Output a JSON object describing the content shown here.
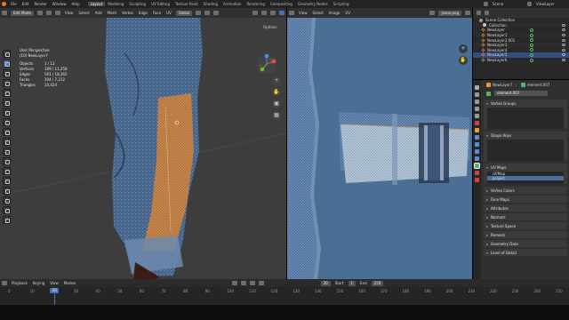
{
  "topbar": {
    "menus": [
      "File",
      "Edit",
      "Render",
      "Window",
      "Help"
    ],
    "workspaces": [
      "Layout",
      "Modeling",
      "Sculpting",
      "UV Editing",
      "Texture Paint",
      "Shading",
      "Animation",
      "Rendering",
      "Compositing",
      "Geometry Nodes",
      "Scripting"
    ],
    "active_workspace": "Layout",
    "scene": "Scene",
    "view_layer": "ViewLayer"
  },
  "viewport_header": {
    "mode": "Edit Mode",
    "menus": [
      "View",
      "Select",
      "Add",
      "Mesh",
      "Vertex",
      "Edge",
      "Face",
      "UV"
    ],
    "orientation": "Global",
    "options": "Options"
  },
  "viewport_info": {
    "view": "User Perspective",
    "object": "(10) NewLayer7",
    "stats": [
      {
        "label": "Objects",
        "value": "1 / 12"
      },
      {
        "label": "Vertices",
        "value": "169 / 11,258"
      },
      {
        "label": "Edges",
        "value": "561 / 18,365"
      },
      {
        "label": "Faces",
        "value": "204 / 7,212"
      },
      {
        "label": "Triangles",
        "value": "14,424"
      }
    ]
  },
  "uv_header": {
    "menus": [
      "View",
      "Select",
      "Image",
      "UV"
    ],
    "image": "jeans.png"
  },
  "outliner": {
    "title": "Scene Collection",
    "rows": [
      {
        "label": "Collection",
        "selected": false
      },
      {
        "label": "NewLayer",
        "selected": false
      },
      {
        "label": "NewLayer1",
        "selected": false
      },
      {
        "label": "NewLayer2.001",
        "selected": false
      },
      {
        "label": "NewLayer3",
        "selected": false
      },
      {
        "label": "NewLayer4",
        "selected": false
      },
      {
        "label": "NewLayer5",
        "selected": true
      },
      {
        "label": "NewLayer6",
        "selected": false
      }
    ]
  },
  "properties": {
    "object_name": "NewLayer7",
    "data_name": "element.007",
    "data_field": "element.007",
    "sections": [
      {
        "label": "Vertex Groups",
        "open": true
      },
      {
        "label": "Shape Keys",
        "open": true
      },
      {
        "label": "UV Maps",
        "open": true
      },
      {
        "label": "Vertex Colors",
        "open": false
      },
      {
        "label": "Face Maps",
        "open": false
      },
      {
        "label": "Attributes",
        "open": false
      },
      {
        "label": "Normals",
        "open": false
      },
      {
        "label": "Texture Space",
        "open": false
      },
      {
        "label": "Remesh",
        "open": false
      },
      {
        "label": "Geometry Data",
        "open": false
      },
      {
        "label": "Level of Detail",
        "open": true
      }
    ],
    "uv_maps": [
      "UVMap",
      "project"
    ]
  },
  "timeline": {
    "menus": [
      "Playback",
      "Keying",
      "View",
      "Marker"
    ],
    "current_frame": "20",
    "start_label": "Start",
    "start": "1",
    "end_label": "End",
    "end": "250",
    "ticks": [
      "0",
      "10",
      "20",
      "30",
      "40",
      "50",
      "60",
      "70",
      "80",
      "90",
      "100",
      "110",
      "120",
      "130",
      "140",
      "150",
      "160",
      "170",
      "180",
      "190",
      "200",
      "210",
      "220",
      "230",
      "240",
      "250"
    ]
  },
  "colors": {
    "accent": "#4772b3",
    "uv_background": "#4b6e95",
    "denim": "#4e6d93",
    "orange_select": "#c88a4e",
    "viewport_bg": "#3d3d3d"
  }
}
